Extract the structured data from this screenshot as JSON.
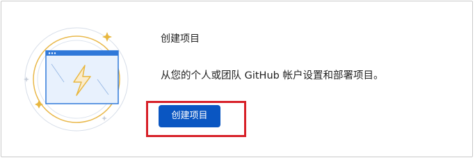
{
  "card": {
    "title": "创建项目",
    "description": "从您的个人或团队 GitHub 帐户设置和部署项目。",
    "button_label": "创建项目"
  },
  "icons": {
    "illustration": "browser-window-lightning-illustration"
  },
  "colors": {
    "button_bg": "#0a56c2",
    "highlight": "#d71f27",
    "illustration_ring": "#e8b740",
    "illustration_window": "#2f78d9"
  }
}
